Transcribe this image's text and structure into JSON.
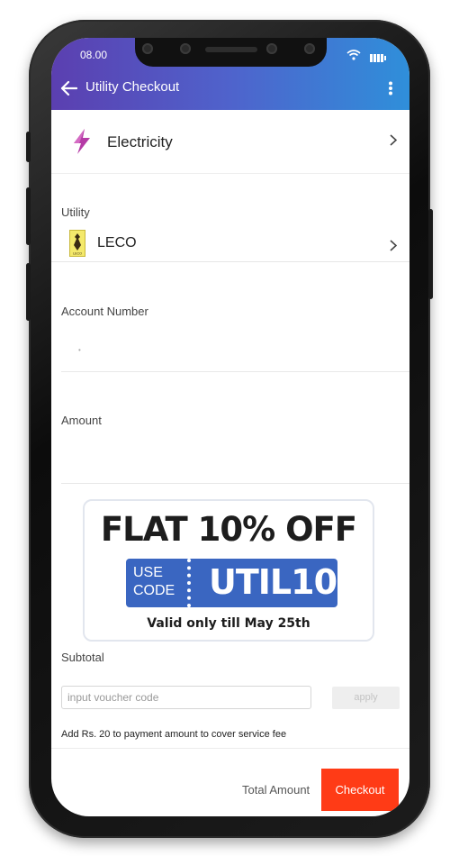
{
  "status_bar": {
    "time": "08.00"
  },
  "header": {
    "title": "Utility Checkout"
  },
  "category": {
    "label": "Electricity"
  },
  "utility": {
    "section_label": "Utility",
    "provider": "LECO",
    "logo_text": "LECO"
  },
  "account": {
    "section_label": "Account Number",
    "placeholder": "•"
  },
  "amount": {
    "section_label": "Amount"
  },
  "promo": {
    "headline": "FLAT 10% OFF",
    "use_label": "USE",
    "code_label": "CODE",
    "code": "UTIL10",
    "validity": "Valid only till May 25th"
  },
  "subtotal": {
    "label": "Subtotal"
  },
  "voucher": {
    "placeholder": "input voucher code",
    "apply_label": "apply"
  },
  "fee_note": "Add Rs. 20 to payment amount to cover service fee",
  "footer": {
    "total_label": "Total Amount",
    "checkout_label": "Checkout"
  },
  "colors": {
    "header_start": "#5b3fb0",
    "header_end": "#2f8fda",
    "checkout": "#ff3b16",
    "promo_code_bg": "#3a66c1"
  }
}
